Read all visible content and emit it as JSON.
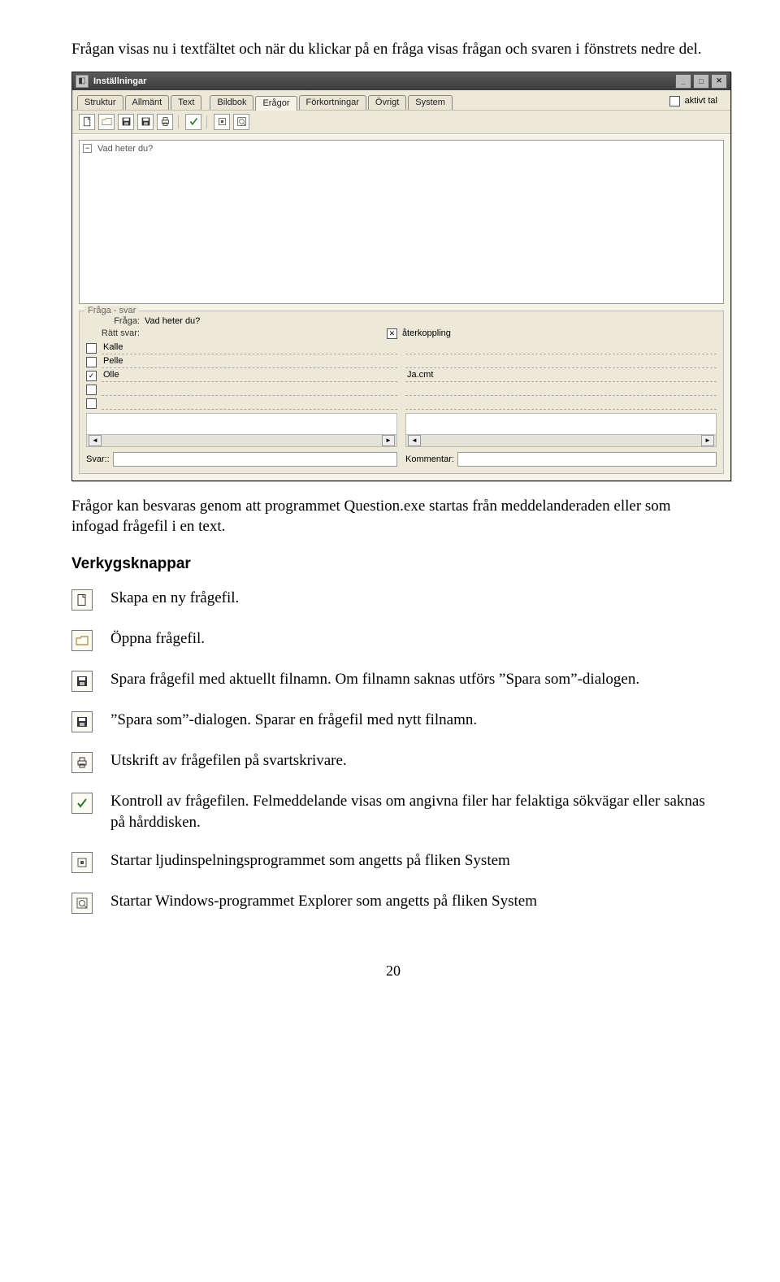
{
  "intro1": "Frågan visas nu i textfältet och när du klickar på en fråga visas frågan och svaren i fönstrets nedre del.",
  "intro2": "Frågor kan besvaras genom att programmet Question.exe startas från meddelanderaden eller som infogad frågefil i en text.",
  "heading": "Verkygsknappar",
  "page_number": "20",
  "window": {
    "title": "Inställningar",
    "tabs": [
      "Struktur",
      "Allmänt",
      "Text",
      "Bildbok",
      "Erågor",
      "Förkortningar",
      "Övrigt",
      "System"
    ],
    "active_tab_index": 4,
    "checkbox_label": "aktivt tal",
    "tree_item": "Vad heter du?",
    "panel_legend": "Fråga - svar",
    "fraga_label": "Fråga:",
    "fraga_value": "Vad heter du?",
    "ratt_svar_label": "Rätt svar:",
    "aterkoppling_label": "återkoppling",
    "answers": [
      "Kalle",
      "Pelle",
      "Olle"
    ],
    "answer_checked_index": 2,
    "feedback_file": "Ja.cmt",
    "svar_label": "Svar::",
    "kommentar_label": "Kommentar:"
  },
  "tools": {
    "new_desc": "Skapa en ny frågefil.",
    "open_desc": "Öppna frågefil.",
    "save_desc": "Spara frågefil med aktuellt filnamn. Om filnamn saknas utförs ”Spara som”-dialogen.",
    "saveas_desc": "”Spara som”-dialogen. Sparar en frågefil med nytt filnamn.",
    "print_desc": "Utskrift av frågefilen på svartskrivare.",
    "check_desc": "Kontroll av frågefilen. Felmeddelande visas om angivna filer har felaktiga sökvägar eller saknas på hårddisken.",
    "record_desc": "Startar ljudinspelningsprogrammet som angetts på fliken System",
    "explorer_desc": "Startar Windows-programmet Explorer som angetts på fliken System"
  }
}
